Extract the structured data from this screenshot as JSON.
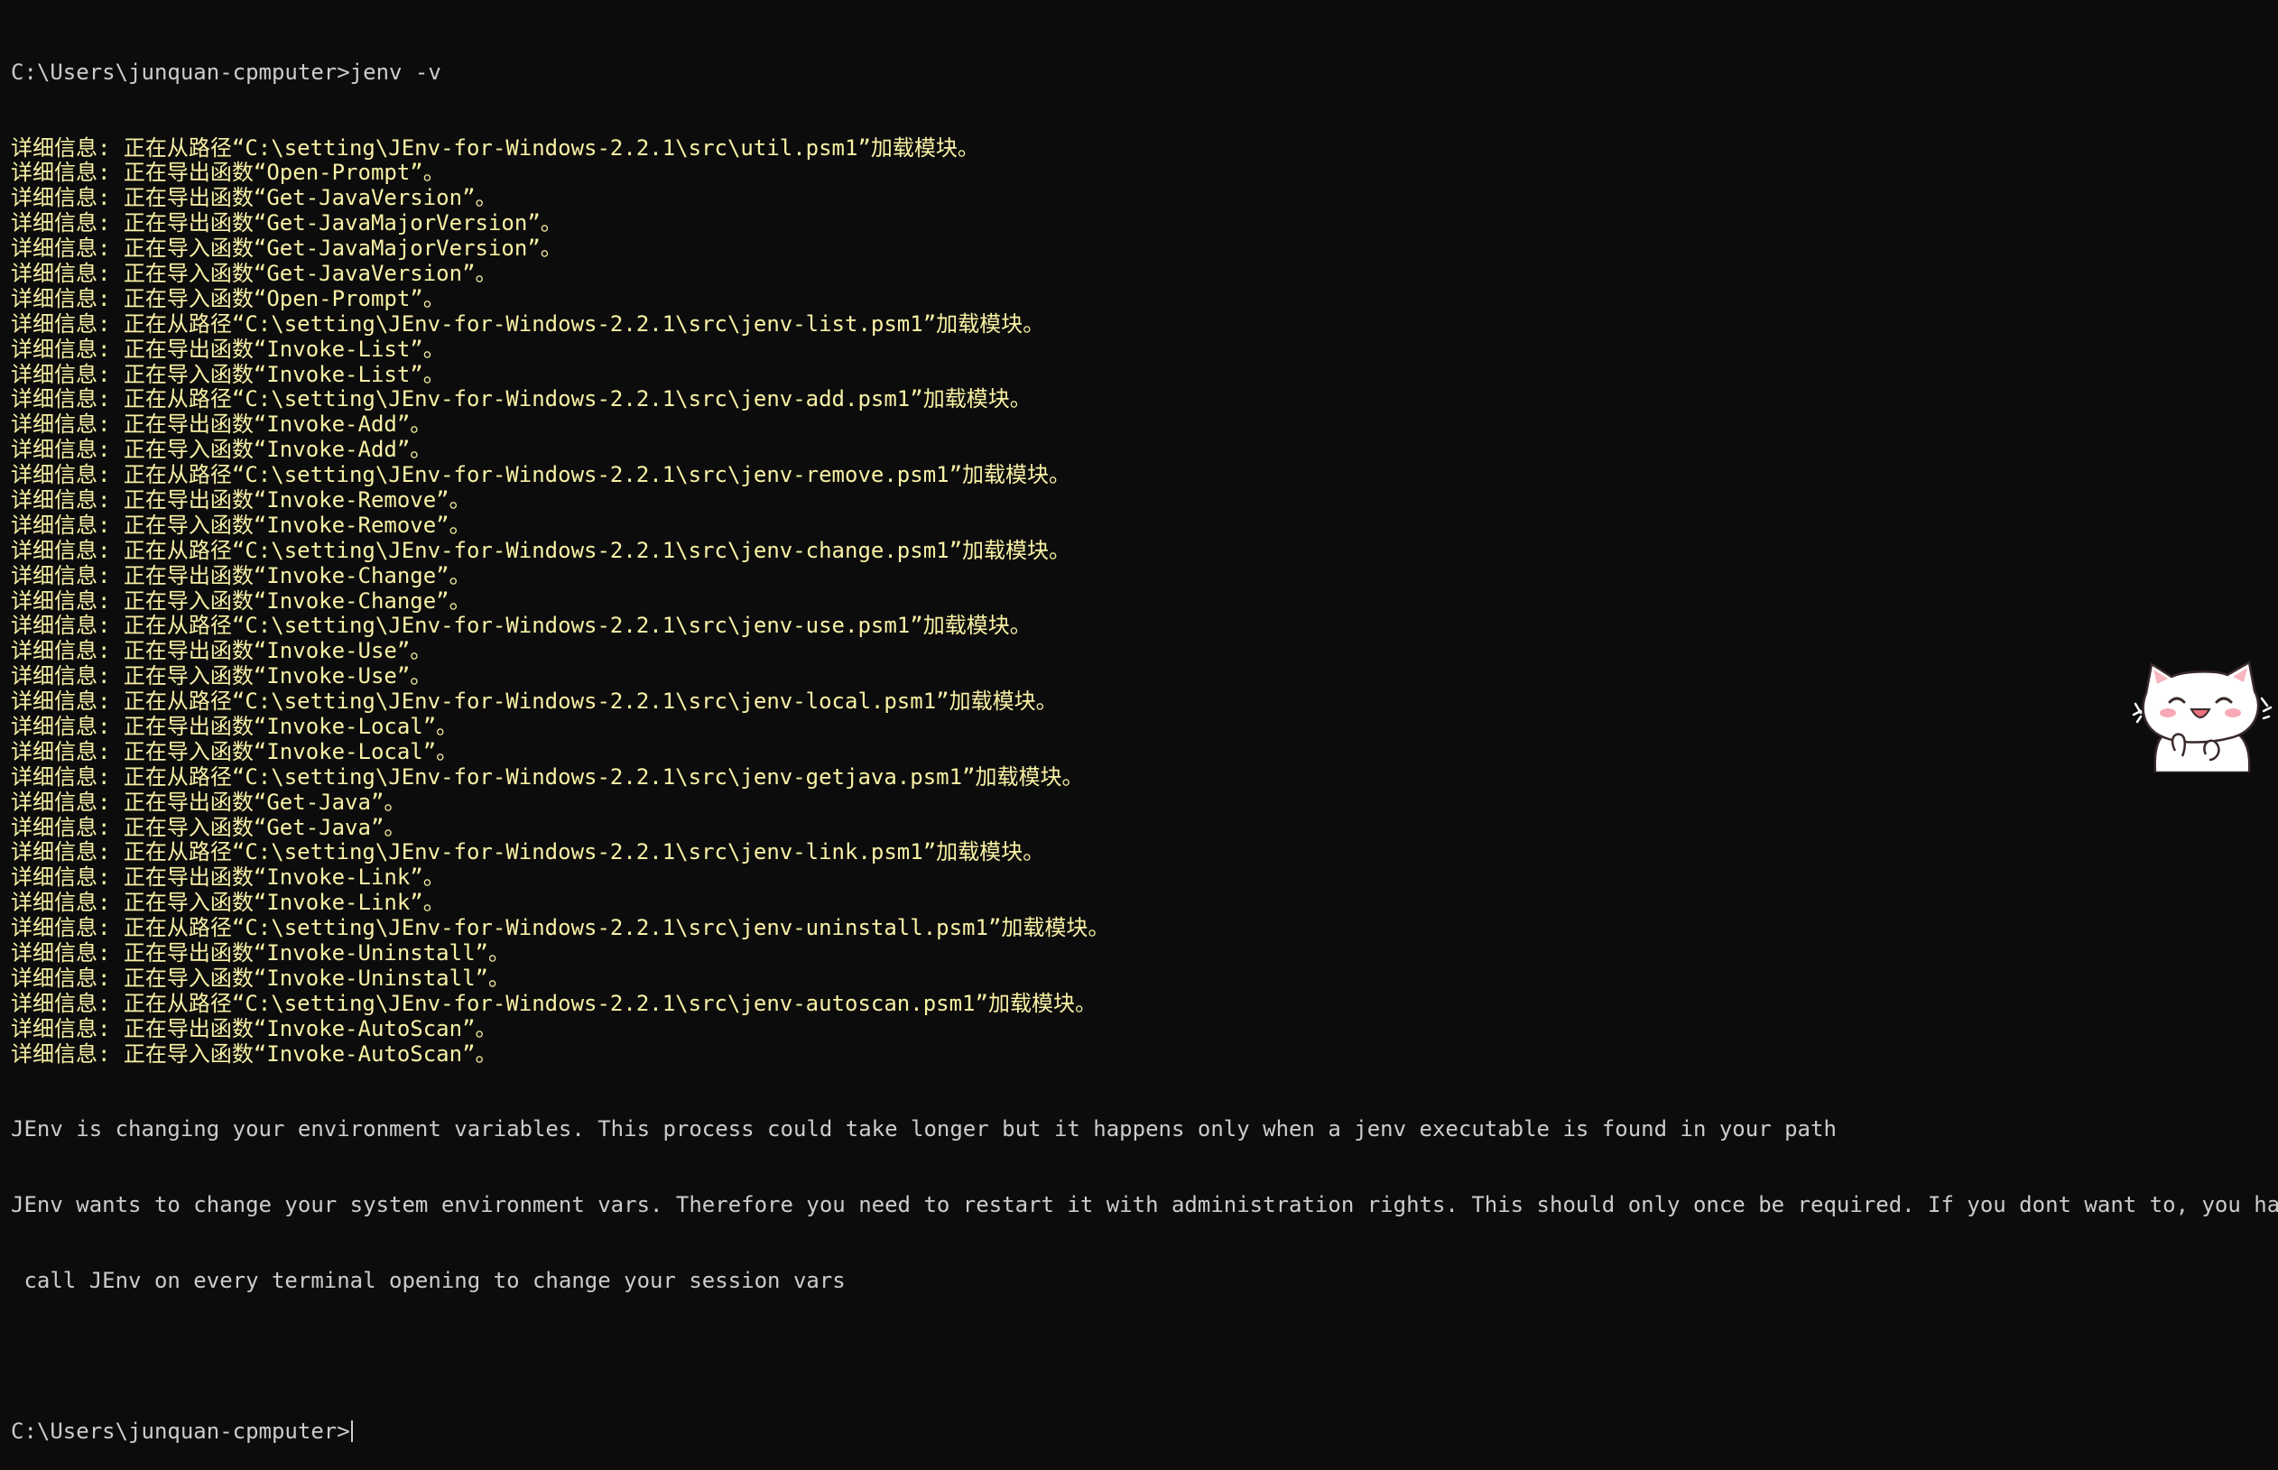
{
  "terminal": {
    "prompt_command": "C:\\Users\\junquan-cpmputer>jenv -v",
    "verbose_lines": [
      "详细信息: 正在从路径“C:\\setting\\JEnv-for-Windows-2.2.1\\src\\util.psm1”加载模块。",
      "详细信息: 正在导出函数“Open-Prompt”。",
      "详细信息: 正在导出函数“Get-JavaVersion”。",
      "详细信息: 正在导出函数“Get-JavaMajorVersion”。",
      "详细信息: 正在导入函数“Get-JavaMajorVersion”。",
      "详细信息: 正在导入函数“Get-JavaVersion”。",
      "详细信息: 正在导入函数“Open-Prompt”。",
      "详细信息: 正在从路径“C:\\setting\\JEnv-for-Windows-2.2.1\\src\\jenv-list.psm1”加载模块。",
      "详细信息: 正在导出函数“Invoke-List”。",
      "详细信息: 正在导入函数“Invoke-List”。",
      "详细信息: 正在从路径“C:\\setting\\JEnv-for-Windows-2.2.1\\src\\jenv-add.psm1”加载模块。",
      "详细信息: 正在导出函数“Invoke-Add”。",
      "详细信息: 正在导入函数“Invoke-Add”。",
      "详细信息: 正在从路径“C:\\setting\\JEnv-for-Windows-2.2.1\\src\\jenv-remove.psm1”加载模块。",
      "详细信息: 正在导出函数“Invoke-Remove”。",
      "详细信息: 正在导入函数“Invoke-Remove”。",
      "详细信息: 正在从路径“C:\\setting\\JEnv-for-Windows-2.2.1\\src\\jenv-change.psm1”加载模块。",
      "详细信息: 正在导出函数“Invoke-Change”。",
      "详细信息: 正在导入函数“Invoke-Change”。",
      "详细信息: 正在从路径“C:\\setting\\JEnv-for-Windows-2.2.1\\src\\jenv-use.psm1”加载模块。",
      "详细信息: 正在导出函数“Invoke-Use”。",
      "详细信息: 正在导入函数“Invoke-Use”。",
      "详细信息: 正在从路径“C:\\setting\\JEnv-for-Windows-2.2.1\\src\\jenv-local.psm1”加载模块。",
      "详细信息: 正在导出函数“Invoke-Local”。",
      "详细信息: 正在导入函数“Invoke-Local”。",
      "详细信息: 正在从路径“C:\\setting\\JEnv-for-Windows-2.2.1\\src\\jenv-getjava.psm1”加载模块。",
      "详细信息: 正在导出函数“Get-Java”。",
      "详细信息: 正在导入函数“Get-Java”。",
      "详细信息: 正在从路径“C:\\setting\\JEnv-for-Windows-2.2.1\\src\\jenv-link.psm1”加载模块。",
      "详细信息: 正在导出函数“Invoke-Link”。",
      "详细信息: 正在导入函数“Invoke-Link”。",
      "详细信息: 正在从路径“C:\\setting\\JEnv-for-Windows-2.2.1\\src\\jenv-uninstall.psm1”加载模块。",
      "详细信息: 正在导出函数“Invoke-Uninstall”。",
      "详细信息: 正在导入函数“Invoke-Uninstall”。",
      "详细信息: 正在从路径“C:\\setting\\JEnv-for-Windows-2.2.1\\src\\jenv-autoscan.psm1”加载模块。",
      "详细信息: 正在导出函数“Invoke-AutoScan”。",
      "详细信息: 正在导入函数“Invoke-AutoScan”。"
    ],
    "message_1": "JEnv is changing your environment variables. This process could take longer but it happens only when a jenv executable is found in your path",
    "message_2a": "JEnv wants to change your system environment vars. Therefore you need to restart it with administration rights. This should only once be required. If you dont want to, you have to",
    "message_2b": " call JEnv on every terminal opening to change your session vars",
    "prompt_current": "C:\\Users\\junquan-cpmputer>"
  },
  "colors": {
    "background": "#0c0c0c",
    "verbose": "#f9f1a5",
    "text": "#cccccc"
  },
  "sticker": {
    "icon": "cat-sticker-icon"
  }
}
